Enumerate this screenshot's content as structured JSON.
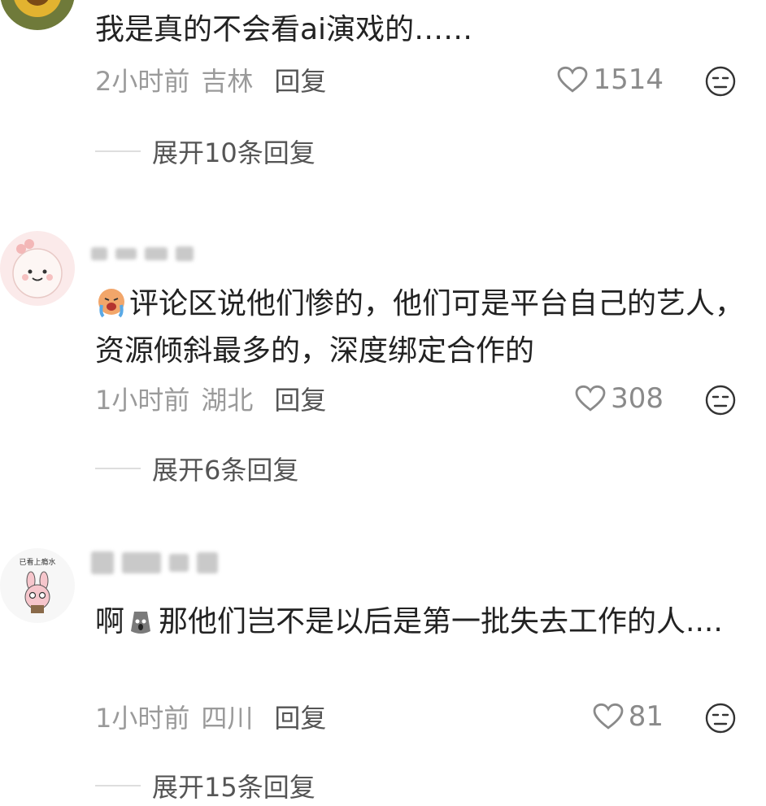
{
  "comments": [
    {
      "text": "我是真的不会看ai演戏的……",
      "time": "2小时前",
      "location": "吉林",
      "reply_label": "回复",
      "likes": "1514",
      "expand_label": "展开10条回复",
      "avatar_icon": "sunflower-avatar"
    },
    {
      "text": "评论区说他们惨的，他们可是平台自己的艺人，资源倾斜最多的，深度绑定合作的",
      "time": "1小时前",
      "location": "湖北",
      "reply_label": "回复",
      "likes": "308",
      "expand_label": "展开6条回复",
      "avatar_icon": "pink-cartoon-avatar",
      "inline_emoji": "crying-emoji"
    },
    {
      "text_before": "啊",
      "text": "那他们岂不是以后是第一批失去工作的人....",
      "time": "1小时前",
      "location": "四川",
      "reply_label": "回复",
      "likes": "81",
      "expand_label": "展开15条回复",
      "avatar_icon": "bunny-avatar",
      "avatar_caption": "已看上瘾水",
      "inline_emoji": "shocked-pouch-emoji"
    }
  ],
  "colors": {
    "text": "#222222",
    "meta": "#9a9a9a",
    "reply": "#555555"
  }
}
